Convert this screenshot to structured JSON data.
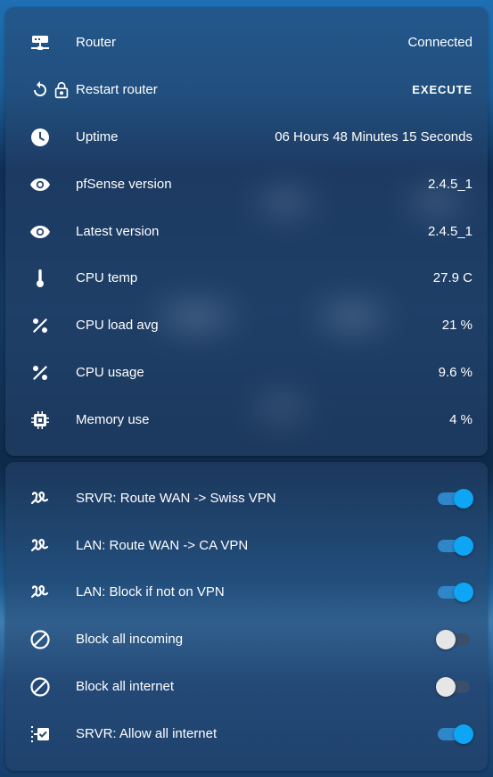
{
  "colors": {
    "accent": "#0ea5f5",
    "text": "#ffffff"
  },
  "status_rows": [
    {
      "icon": "router-network-icon",
      "label": "Router",
      "value": "Connected"
    },
    {
      "icon": "restart-lock-icon",
      "label": "Restart router",
      "action": "EXECUTE"
    },
    {
      "icon": "clock-icon",
      "label": "Uptime",
      "value": "06 Hours 48 Minutes 15 Seconds"
    },
    {
      "icon": "eye-icon",
      "label": "pfSense version",
      "value": "2.4.5_1"
    },
    {
      "icon": "eye-icon",
      "label": "Latest version",
      "value": "2.4.5_1"
    },
    {
      "icon": "thermometer-icon",
      "label": "CPU temp",
      "value": "27.9 C"
    },
    {
      "icon": "percent-icon",
      "label": "CPU load avg",
      "value": "21 %"
    },
    {
      "icon": "percent-icon",
      "label": "CPU usage",
      "value": "9.6 %"
    },
    {
      "icon": "chip-icon",
      "label": "Memory use",
      "value": "4 %"
    }
  ],
  "switch_rows": [
    {
      "icon": "routes-icon",
      "label": "SRVR: Route WAN -> Swiss VPN",
      "state": "on"
    },
    {
      "icon": "routes-icon",
      "label": "LAN: Route WAN -> CA VPN",
      "state": "on"
    },
    {
      "icon": "routes-icon",
      "label": "LAN: Block if not on VPN",
      "state": "on"
    },
    {
      "icon": "block-cancel-icon",
      "label": "Block all incoming",
      "state": "off"
    },
    {
      "icon": "block-cancel-icon",
      "label": "Block all internet",
      "state": "off"
    },
    {
      "icon": "checkbox-list-icon",
      "label": "SRVR: Allow all internet",
      "state": "on"
    }
  ]
}
